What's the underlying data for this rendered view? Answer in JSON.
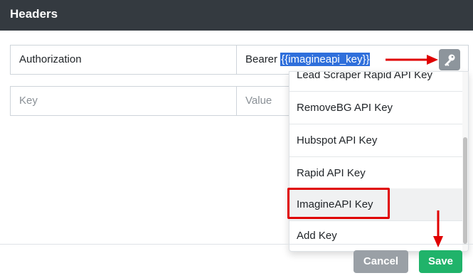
{
  "panel": {
    "title": "Headers"
  },
  "header_row": {
    "name_value": "Authorization",
    "value_prefix": "Bearer ",
    "value_selected": "{{imagineapi_key}}"
  },
  "new_row": {
    "key_placeholder": "Key",
    "value_placeholder": "Value"
  },
  "dropdown": {
    "items": [
      {
        "label": "Lead Scraper Rapid API Key"
      },
      {
        "label": "RemoveBG API Key"
      },
      {
        "label": "Hubspot API Key"
      },
      {
        "label": "Rapid API Key"
      },
      {
        "label": "ImagineAPI Key"
      },
      {
        "label": "Add Key"
      }
    ],
    "highlighted": "ImagineAPI Key"
  },
  "footer": {
    "cancel_label": "Cancel",
    "save_label": "Save"
  },
  "colors": {
    "header_bg": "#343a40",
    "selection": "#2f6fdb",
    "annotation_red": "#e00000",
    "save_green": "#20b36a",
    "cancel_gray": "#9aa0a6"
  },
  "icons": {
    "key_button": "key-icon"
  }
}
